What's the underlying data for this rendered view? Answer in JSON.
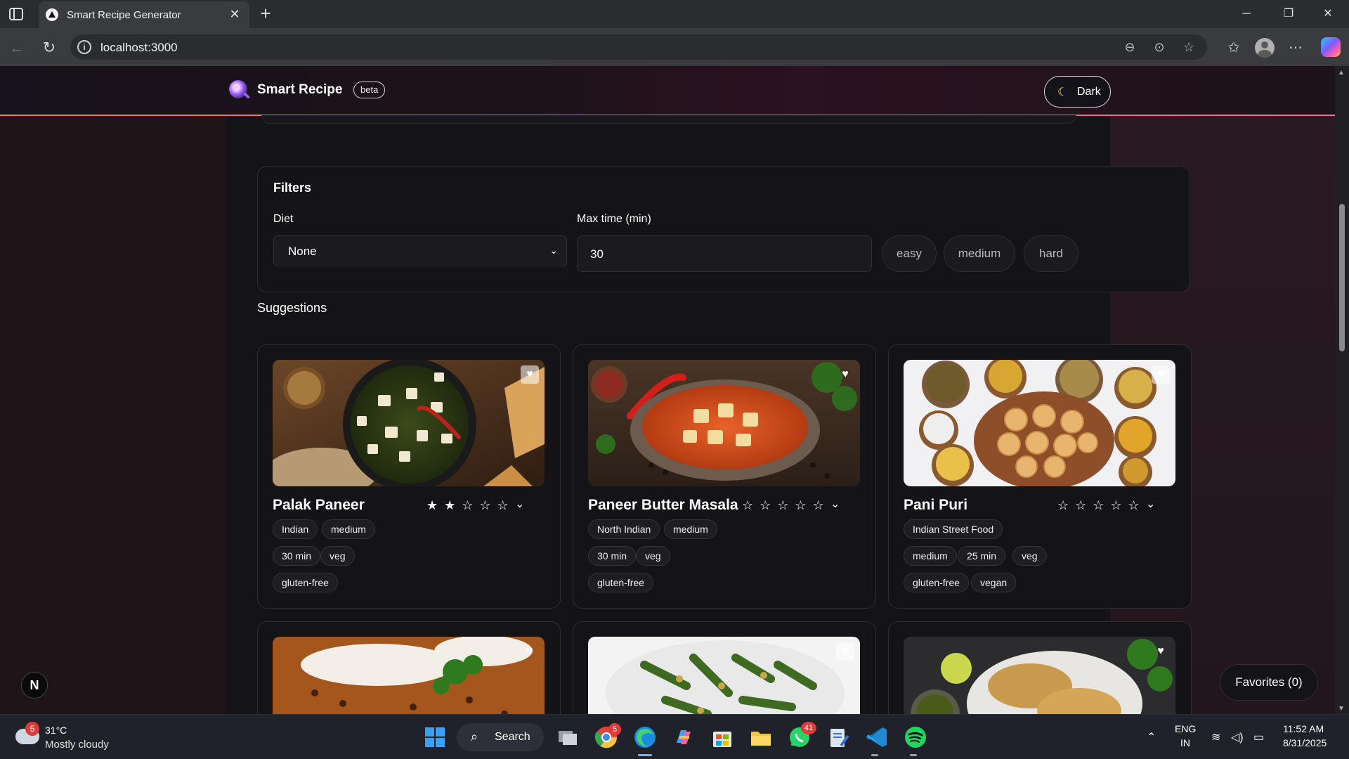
{
  "browser": {
    "tab_title": "Smart Recipe Generator",
    "url": "localhost:3000"
  },
  "header": {
    "brand": "Smart Recipe",
    "badge": "beta",
    "theme_label": "Dark"
  },
  "filters": {
    "title": "Filters",
    "diet_label": "Diet",
    "diet_value": "None",
    "time_label": "Max time (min)",
    "time_value": "30",
    "difficulties": [
      "easy",
      "medium",
      "hard"
    ]
  },
  "suggestions_title": "Suggestions",
  "cards": [
    {
      "name": "Palak Paneer",
      "rating": 2,
      "tags_row1": [
        "Indian",
        "medium"
      ],
      "tags_row2": [
        "30 min",
        "veg"
      ],
      "tags_row3": [
        "gluten-free"
      ]
    },
    {
      "name": "Paneer Butter Masala",
      "rating": 0,
      "tags_row1": [
        "North Indian",
        "medium"
      ],
      "tags_row2": [
        "30 min",
        "veg"
      ],
      "tags_row3": [
        "gluten-free"
      ]
    },
    {
      "name": "Pani Puri",
      "rating": 0,
      "tags_row1": [
        "Indian Street Food"
      ],
      "tags_row2": [
        "medium",
        "25 min",
        "veg"
      ],
      "tags_row3": [
        "gluten-free",
        "vegan"
      ]
    }
  ],
  "favorites_label": "Favorites (0)",
  "next_badge": "N",
  "taskbar": {
    "weather_badge": "5",
    "temp": "31°C",
    "weather": "Mostly cloudy",
    "search": "Search",
    "chrome_badge": "5",
    "whatsapp_badge": "41",
    "lang1": "ENG",
    "lang2": "IN",
    "time": "11:52 AM",
    "date": "8/31/2025"
  },
  "colors": {
    "accent_line_start": "#ff7a3d",
    "accent_line_end": "#ff6b9e",
    "card_bg": "#141418",
    "page_bg": "#1b1114"
  },
  "icons": [
    "sidebar-toggle-icon",
    "close-icon",
    "plus-icon",
    "back-icon",
    "reload-icon",
    "info-icon",
    "zoom-out-icon",
    "reader-icon",
    "star-outline-icon",
    "favorites-icon",
    "profile-icon",
    "more-icon",
    "copilot-icon",
    "moon-icon",
    "heart-icon",
    "chevron-down-icon"
  ]
}
